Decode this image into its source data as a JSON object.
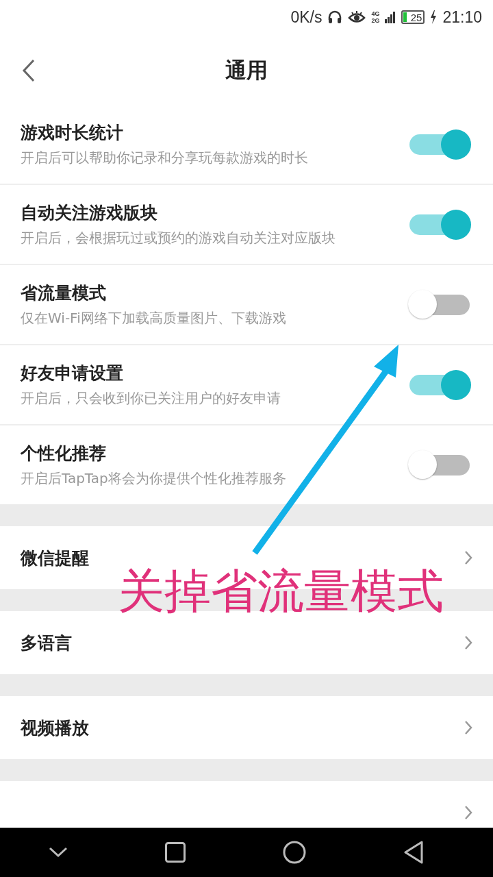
{
  "status_bar": {
    "speed": "0K/s",
    "network": "4G",
    "network_2": "2G",
    "battery": "25",
    "time": "21:10"
  },
  "header": {
    "title": "通用"
  },
  "toggles": [
    {
      "title": "游戏时长统计",
      "description": "开启后可以帮助你记录和分享玩每款游戏的时长",
      "on": true
    },
    {
      "title": "自动关注游戏版块",
      "description": "开启后，会根据玩过或预约的游戏自动关注对应版块",
      "on": true
    },
    {
      "title": "省流量模式",
      "description": "仅在Wi-Fi网络下加载高质量图片、下载游戏",
      "on": false
    },
    {
      "title": "好友申请设置",
      "description": "开启后，只会收到你已关注用户的好友申请",
      "on": true
    },
    {
      "title": "个性化推荐",
      "description": "开启后TapTap将会为你提供个性化推荐服务",
      "on": false
    }
  ],
  "links": [
    {
      "title": "微信提醒"
    },
    {
      "title": "多语言"
    },
    {
      "title": "视频播放"
    }
  ],
  "annotation": {
    "text": "关掉省流量模式"
  }
}
